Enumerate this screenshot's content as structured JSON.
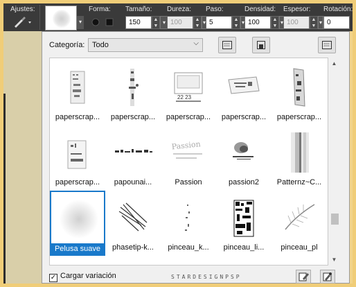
{
  "toolbar": {
    "ajustes_label": "Ajustes:",
    "forma_label": "Forma:",
    "tamano_label": "Tamaño:",
    "tamano_value": "150",
    "dureza_label": "Dureza:",
    "dureza_value": "100",
    "paso_label": "Paso:",
    "paso_value": "5",
    "densidad_label": "Densidad:",
    "densidad_value": "100",
    "espesor_label": "Espesor:",
    "espesor_value": "100",
    "rotacion_label": "Rotación:",
    "rotacion_value": "0"
  },
  "panel": {
    "categoria_label": "Categoría:",
    "categoria_value": "Todo",
    "brushes": [
      {
        "name": "paperscrap...",
        "icon": "paperscrap-thumb-1"
      },
      {
        "name": "paperscrap...",
        "icon": "paperscrap-thumb-2"
      },
      {
        "name": "paperscrap...",
        "icon": "paperscrap-thumb-3"
      },
      {
        "name": "paperscrap...",
        "icon": "paperscrap-thumb-4"
      },
      {
        "name": "paperscrap...",
        "icon": "paperscrap-thumb-5"
      },
      {
        "name": "paperscrap...",
        "icon": "paperscrap-thumb-6"
      },
      {
        "name": "papounai...",
        "icon": "papounai-thumb"
      },
      {
        "name": "Passion",
        "icon": "passion-thumb"
      },
      {
        "name": "passion2",
        "icon": "passion2-thumb"
      },
      {
        "name": "Patternz~C...",
        "icon": "patternz-thumb"
      },
      {
        "name": "Pelusa suave",
        "icon": "pelusa-thumb",
        "selected": true
      },
      {
        "name": "phasetip-k...",
        "icon": "phasetip-thumb"
      },
      {
        "name": "pinceau_k...",
        "icon": "pinceau-k-thumb"
      },
      {
        "name": "pinceau_li...",
        "icon": "pinceau-li-thumb"
      },
      {
        "name": "pinceau_pl",
        "icon": "pinceau-pl-thumb"
      }
    ],
    "cargar_label": "Cargar variación",
    "cargar_checked": true,
    "watermark": "STARDESIGNPSP"
  }
}
